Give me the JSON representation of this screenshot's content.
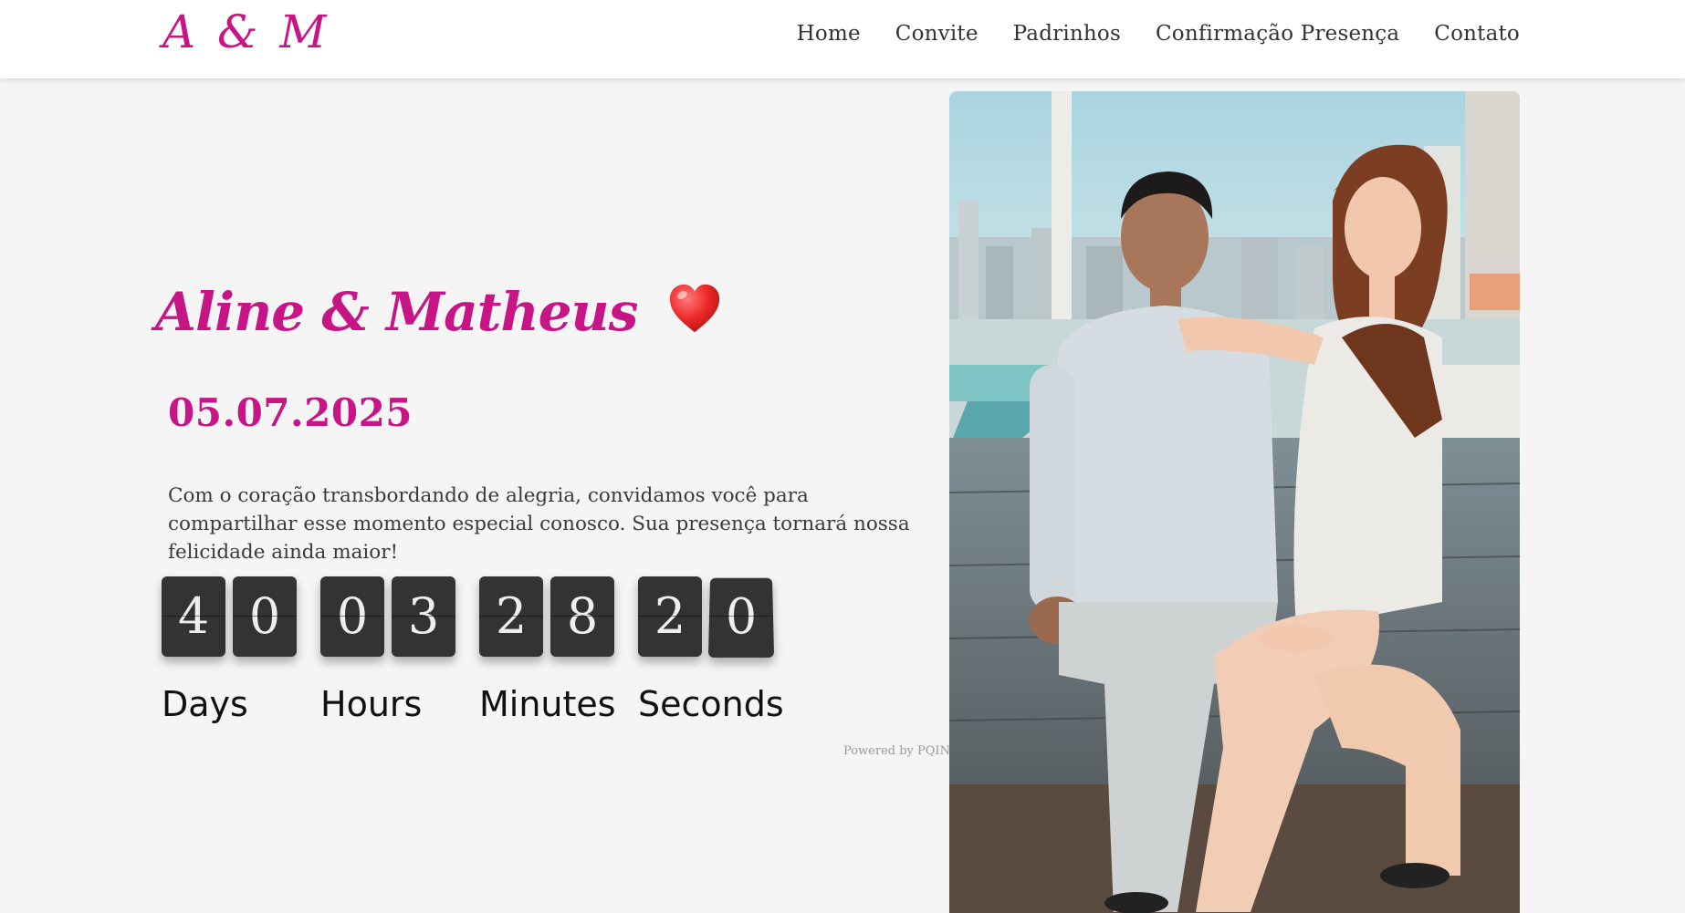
{
  "brand": {
    "logo_text": "A & M"
  },
  "nav": {
    "items": [
      "Home",
      "Convite",
      "Padrinhos",
      "Confirmação Presença",
      "Contato"
    ]
  },
  "hero": {
    "couple_names": "Aline  &  Matheus",
    "heart_icon": "red-heart-emoji",
    "date": "05.07.2025",
    "message": "Com o coração transbordando de alegria, convidamos você para compartilhar esse momento especial conosco. Sua presença tornará nossa felicidade ainda maior!"
  },
  "countdown": {
    "days": {
      "digits": [
        "4",
        "0"
      ],
      "label": "Days"
    },
    "hours": {
      "digits": [
        "0",
        "3"
      ],
      "label": "Hours"
    },
    "minutes": {
      "digits": [
        "2",
        "8"
      ],
      "label": "Minutes"
    },
    "seconds": {
      "digits": [
        "2",
        "0"
      ],
      "label": "Seconds"
    }
  },
  "powered_by": "Powered by PQINA",
  "photo": {
    "description_icon": "couple-photo"
  },
  "colors": {
    "accent": "#c71585",
    "digit_bg": "#333333",
    "page_bg": "#f5f5f5"
  }
}
